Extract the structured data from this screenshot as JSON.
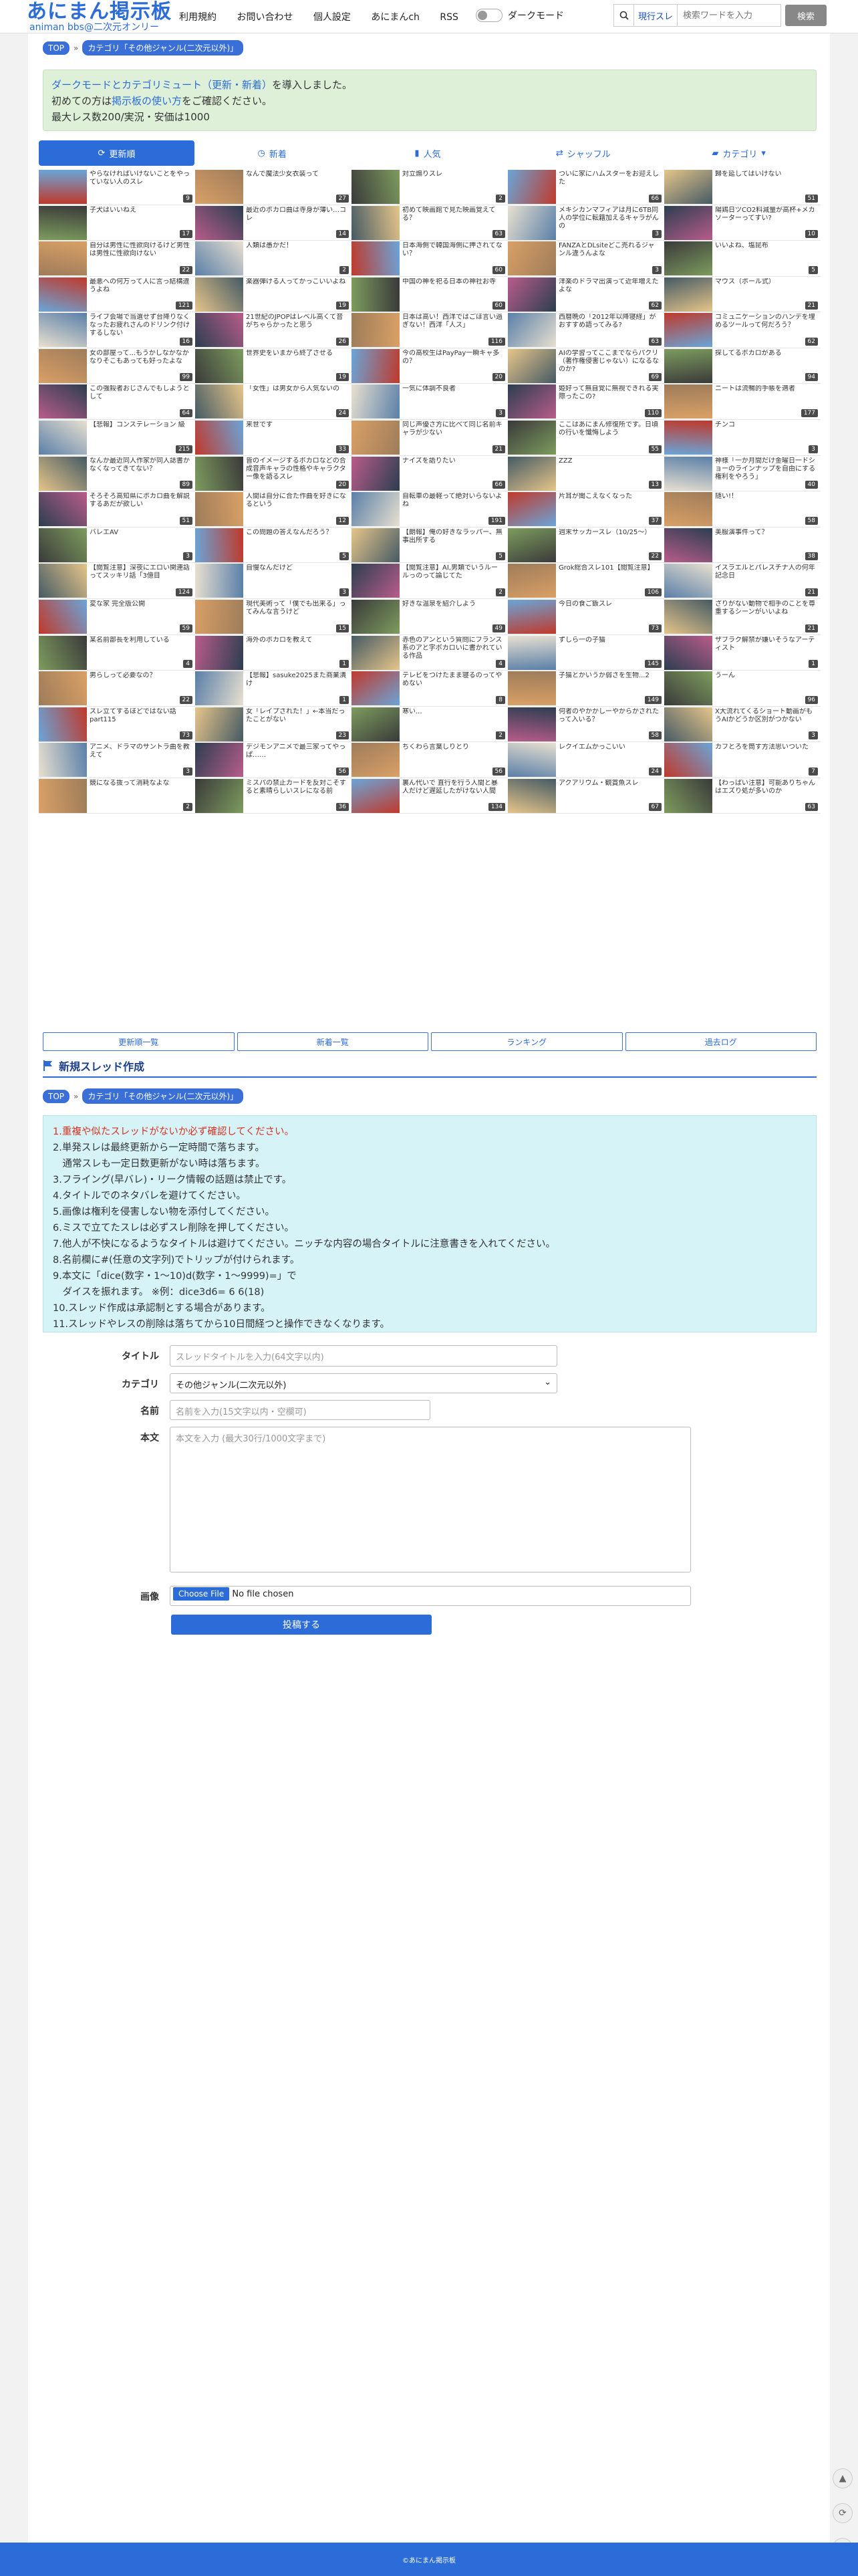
{
  "header": {
    "logo_title": "あにまん掲示板",
    "logo_sub": "animan bbs@二次元オンリー",
    "nav": [
      "利用規約",
      "お問い合わせ",
      "個人設定",
      "あにまんch",
      "RSS"
    ],
    "dark_mode_label": "ダークモード",
    "search_scope": "現行スレ",
    "search_placeholder": "検索ワードを入力",
    "search_button": "検索"
  },
  "breadcrumb": {
    "top": "TOP",
    "category": "カテゴリ「その他ジャンル(二次元以外)」"
  },
  "notice": {
    "line1_link": "ダークモードとカテゴリミュート（更新・新着）",
    "line1_rest": "を導入しました。",
    "line2_pre": "初めての方は",
    "line2_link": "掲示板の使い方",
    "line2_post": "をご確認ください。",
    "line3": "最大レス数200/実況・安価は1000"
  },
  "tabs": [
    "更新順",
    "新着",
    "人気",
    "シャッフル",
    "カテゴリ"
  ],
  "accent_color": "#2b6cd9",
  "threads": [
    {
      "t": "やらなければいけないことをやっていない人のスレ",
      "c": "9"
    },
    {
      "t": "なんで魔法少女衣装って",
      "c": "27"
    },
    {
      "t": "対立煽りスレ",
      "c": "2"
    },
    {
      "t": "ついに家にハムスターをお迎えした",
      "c": "66"
    },
    {
      "t": "歸を延してはいけない",
      "c": "51"
    },
    {
      "t": "子犬はいいねえ",
      "c": "17"
    },
    {
      "t": "最近のボカロ曲は寺身が薄い…コレ",
      "c": "14"
    },
    {
      "t": "初めて映画館で見た映画覚えてる？",
      "c": "63"
    },
    {
      "t": "メキシカンマフィアは月に6TB同人の学位に転籍加えるキャラがんの",
      "c": "3"
    },
    {
      "t": "陽鶏日ツCO2料減量が高杯+メカソーターってすい?",
      "c": "10"
    },
    {
      "t": "自分は男性に性欲向けるけど男性は男性に性欲向けない",
      "c": "22"
    },
    {
      "t": "人類は愚かだ！",
      "c": "2"
    },
    {
      "t": "日本海側で韓国海側に押されてない？",
      "c": "60"
    },
    {
      "t": "FANZAとDLsiteどこ売れるジャンル違うんよな",
      "c": "3"
    },
    {
      "t": "いいよね、塩昆布",
      "c": "5"
    },
    {
      "t": "最悪への何万って人に言っ結構違うよね",
      "c": "121"
    },
    {
      "t": "楽器弾ける人ってかっこいいよね",
      "c": "19"
    },
    {
      "t": "中国の神を祀る日本の神社お寺",
      "c": "60"
    },
    {
      "t": "洋楽のドラマ出演って近年増えたよな",
      "c": "62"
    },
    {
      "t": "マウス（ボール式）",
      "c": "21"
    },
    {
      "t": "ライブ会場で当選せず台降りなくなったお疲れさんのドリンク付けするしない",
      "c": "16"
    },
    {
      "t": "21世紀のJPOPはレベル高くて音がちゃらかったと思う",
      "c": "26"
    },
    {
      "t": "日本は高い！西洋ではごほ言い過ぎない！西洋「人ス」",
      "c": "116"
    },
    {
      "t": "西暦晩の「2012年以降寝経」がおすすめ語ってみる?",
      "c": "63"
    },
    {
      "t": "コミュニケーションのハンデを埋めるツールって何だろう？",
      "c": "62"
    },
    {
      "t": "女の部屋って...もうかしなかなかなりそこもあっても好ったよな",
      "c": "99"
    },
    {
      "t": "世界史をいまから終了させる",
      "c": "19"
    },
    {
      "t": "今の高校生はPayPay一瞬キャ多の？",
      "c": "20"
    },
    {
      "t": "AIの学習ってここまでならパクリ（著作権侵害じゃない）になるなのか?",
      "c": "69"
    },
    {
      "t": "探してるボカロがある",
      "c": "94"
    },
    {
      "t": "この強殺者おじさんでもしようとして",
      "c": "64"
    },
    {
      "t": "「女性」は男女から人気ないの",
      "c": "24"
    },
    {
      "t": "一気に体調不良者",
      "c": "3"
    },
    {
      "t": "姫好って無自覚に無視できれる実際ったこの?",
      "c": "110"
    },
    {
      "t": "ニートは流暢的手帳を適者",
      "c": "177"
    },
    {
      "t": "【悲報】コンステレーション 級",
      "c": "215"
    },
    {
      "t": "来世です",
      "c": "33"
    },
    {
      "t": "同じ声優さ方に比べて同じ名前キャラが少ない",
      "c": "21"
    },
    {
      "t": "ここはあにまん修復所です。日頃の行いを懺悔しよう",
      "c": "55"
    },
    {
      "t": "チンコ",
      "c": "3"
    },
    {
      "t": "なんか最近同人作家が同人誌書かなくなってきてない？",
      "c": "89"
    },
    {
      "t": "皆のイメージするボカロなどの合成音声キャラの性格やキャラクター像を語るスレ",
      "c": "20"
    },
    {
      "t": "ナイズを語りたい",
      "c": "66"
    },
    {
      "t": "ZZZ",
      "c": "13"
    },
    {
      "t": "神様「一か月間だけ金曜日一ドショーのラインナップを自由にする権利をやろう」",
      "c": "40"
    },
    {
      "t": "そろそろ高知県にボカロ曲を解説するあだが欲しい",
      "c": "51"
    },
    {
      "t": "人間は自分に合た作曲を好きになるという",
      "c": "12"
    },
    {
      "t": "自転車の最軽って絶対いらないよね",
      "c": "191"
    },
    {
      "t": "片耳が聞こえなくなった",
      "c": "37"
    },
    {
      "t": "随い!！",
      "c": "58"
    },
    {
      "t": "バレエAV",
      "c": "3"
    },
    {
      "t": "この問題の答えなんだろう？",
      "c": "5"
    },
    {
      "t": "【朗報】俺の好きなラッパー、無事出所する",
      "c": "5"
    },
    {
      "t": "週末サッカースレ（10/25〜）",
      "c": "22"
    },
    {
      "t": "美服演事件って？",
      "c": "38"
    },
    {
      "t": "【閲覧注意】深夜にエロい関連話ってスッキリ話「3億目",
      "c": "124"
    },
    {
      "t": "自慢なんだけど",
      "c": "3"
    },
    {
      "t": "【閲覧注意】AI,男類でいうルールっのって論じてた",
      "c": "2"
    },
    {
      "t": "Grok総合スレ101【閲覧注意】",
      "c": "106"
    },
    {
      "t": "イスラエルとパレスチナ人の何年記念日",
      "c": "21"
    },
    {
      "t": "変な家 完全版公開",
      "c": "59"
    },
    {
      "t": "現代美術って「僕でも出来る」ってみんな言うけど",
      "c": "15"
    },
    {
      "t": "好きな温泉を紹介しよう",
      "c": "49"
    },
    {
      "t": "今日の食ご飯スレ",
      "c": "73"
    },
    {
      "t": "ざりがない動物で相手のことを尊重するシーンがいいよね",
      "c": "21"
    },
    {
      "t": "某名前部長を利用している",
      "c": "4"
    },
    {
      "t": "海外のボカロを教えて",
      "c": "1"
    },
    {
      "t": "赤色のアンという質問にフランス系のアと字ボカロいに書かれている作品",
      "c": "4"
    },
    {
      "t": "ずしら一の子猫",
      "c": "145"
    },
    {
      "t": "ザブラク解禁が嫌いそうなアーティスト",
      "c": "1"
    },
    {
      "t": "男らしって必要なの？",
      "c": "22"
    },
    {
      "t": "【悲報】sasuke2025また商業潰け",
      "c": "1"
    },
    {
      "t": "テレビをつけたまま寝るのってやめない",
      "c": "8"
    },
    {
      "t": "子猫とかいうか弱さを生物...2",
      "c": "149"
    },
    {
      "t": "うーん",
      "c": "96"
    },
    {
      "t": "スレ立てするほどではない話part115",
      "c": "73"
    },
    {
      "t": "女「レイプされた！」←本当だったことがない",
      "c": "23"
    },
    {
      "t": "寒い...",
      "c": "2"
    },
    {
      "t": "何者のやかかしーやからかされたって入いる？",
      "c": "58"
    },
    {
      "t": "X大流れてくるショート動画がもうAIかどうか区別がつかない",
      "c": "3"
    },
    {
      "t": "アニメ、ドラマのサントラ曲を教えて",
      "c": "3"
    },
    {
      "t": "デジモンアニメで最三家ってやっぱ……",
      "c": "56"
    },
    {
      "t": "ちくわら言葉しりとり",
      "c": "56"
    },
    {
      "t": "レクイエムかっこいい",
      "c": "24"
    },
    {
      "t": "カフとろを筒す方法思いついた",
      "c": "7"
    },
    {
      "t": "競になる抜って消耗なよな",
      "c": "2"
    },
    {
      "t": "ミスパの禁止カードを反対こそすると素晴らしいスレになる前",
      "c": "36"
    },
    {
      "t": "裏ん代いで 直行を行う人間と暴人だけど遅延したがけない人間",
      "c": "134"
    },
    {
      "t": "アクアリウム・観賞魚スレ",
      "c": "67"
    },
    {
      "t": "【わっぱい注意】可能ありちゃんはエズり処が多いのか",
      "c": "63"
    }
  ],
  "bottom_nav": [
    "更新順一覧",
    "新着一覧",
    "ランキング",
    "過去ログ"
  ],
  "new_thread": {
    "heading": "新規スレッド作成",
    "rules": [
      "1.重複や似たスレッドがないか必ず確認してください。",
      "2.単発スレは最終更新から一定時間で落ちます。",
      "　通常スレも一定日数更新がない時は落ちます。",
      "3.フライング(早バレ)・リーク情報の話題は禁止です。",
      "4.タイトルでのネタバレを避けてください。",
      "5.画像は権利を侵害しない物を添付してください。",
      "6.ミスで立てたスレは必ずスレ削除を押してください。",
      "7.他人が不快になるようなタイトルは避けてください。ニッチな内容の場合タイトルに注意書きを入れてください。",
      "8.名前欄に#(任意の文字列)でトリップが付けられます。",
      "9.本文に「dice(数字・1〜10)d(数字・1〜9999)=」で",
      "　ダイスを振れます。 ※例：dice3d6= 6 6(18)",
      "10.スレッド作成は承認制とする場合があります。",
      "11.スレッドやレスの削除は落ちてから10日間経つと操作できなくなります。"
    ],
    "title_label": "タイトル",
    "title_placeholder": "スレッドタイトルを入力(64文字以内)",
    "category_label": "カテゴリ",
    "category_value": "その他ジャンル(二次元以外)",
    "name_label": "名前",
    "name_placeholder": "名前を入力(15文字以内・空欄可)",
    "body_label": "本文",
    "body_placeholder": "本文を入力 (最大30行/1000文字まで)",
    "image_label": "画像",
    "file_button": "Choose File",
    "file_status": "No file chosen",
    "submit": "投稿する"
  },
  "footer": "©あにまん掲示板"
}
